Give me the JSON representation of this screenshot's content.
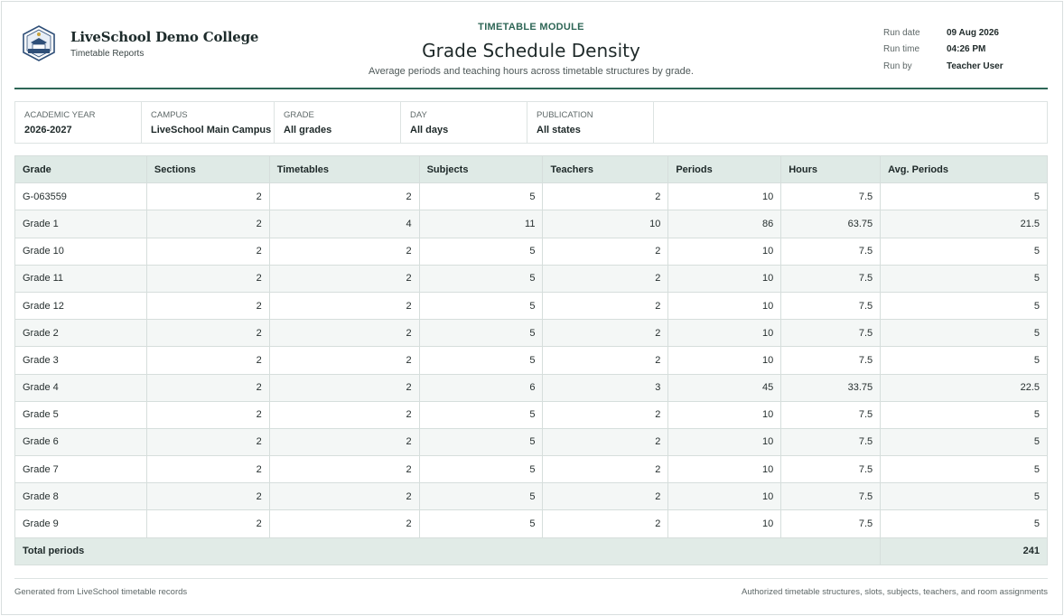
{
  "brand": {
    "name": "LiveSchool Demo College",
    "subtitle": "Timetable Reports",
    "logo_icon": "school-crest-icon"
  },
  "header": {
    "module": "TIMETABLE MODULE",
    "title": "Grade Schedule Density",
    "description": "Average periods and teaching hours across timetable structures by grade."
  },
  "meta": [
    {
      "label": "Run date",
      "value": "09 Aug 2026"
    },
    {
      "label": "Run time",
      "value": "04:26 PM"
    },
    {
      "label": "Run by",
      "value": "Teacher User"
    }
  ],
  "filters": [
    {
      "label": "ACADEMIC YEAR",
      "value": "2026-2027"
    },
    {
      "label": "CAMPUS",
      "value": "LiveSchool Main Campus"
    },
    {
      "label": "GRADE",
      "value": "All grades"
    },
    {
      "label": "DAY",
      "value": "All days"
    },
    {
      "label": "PUBLICATION",
      "value": "All states"
    }
  ],
  "table": {
    "columns": [
      "Grade",
      "Sections",
      "Timetables",
      "Subjects",
      "Teachers",
      "Periods",
      "Hours",
      "Avg. Periods"
    ],
    "rows": [
      [
        "G-063559",
        "2",
        "2",
        "5",
        "2",
        "10",
        "7.5",
        "5"
      ],
      [
        "Grade 1",
        "2",
        "4",
        "11",
        "10",
        "86",
        "63.75",
        "21.5"
      ],
      [
        "Grade 10",
        "2",
        "2",
        "5",
        "2",
        "10",
        "7.5",
        "5"
      ],
      [
        "Grade 11",
        "2",
        "2",
        "5",
        "2",
        "10",
        "7.5",
        "5"
      ],
      [
        "Grade 12",
        "2",
        "2",
        "5",
        "2",
        "10",
        "7.5",
        "5"
      ],
      [
        "Grade 2",
        "2",
        "2",
        "5",
        "2",
        "10",
        "7.5",
        "5"
      ],
      [
        "Grade 3",
        "2",
        "2",
        "5",
        "2",
        "10",
        "7.5",
        "5"
      ],
      [
        "Grade 4",
        "2",
        "2",
        "6",
        "3",
        "45",
        "33.75",
        "22.5"
      ],
      [
        "Grade 5",
        "2",
        "2",
        "5",
        "2",
        "10",
        "7.5",
        "5"
      ],
      [
        "Grade 6",
        "2",
        "2",
        "5",
        "2",
        "10",
        "7.5",
        "5"
      ],
      [
        "Grade 7",
        "2",
        "2",
        "5",
        "2",
        "10",
        "7.5",
        "5"
      ],
      [
        "Grade 8",
        "2",
        "2",
        "5",
        "2",
        "10",
        "7.5",
        "5"
      ],
      [
        "Grade 9",
        "2",
        "2",
        "5",
        "2",
        "10",
        "7.5",
        "5"
      ]
    ],
    "total": {
      "label": "Total periods",
      "value": "241"
    }
  },
  "footer": {
    "left": "Generated from LiveSchool timetable records",
    "right": "Authorized timetable structures, slots, subjects, teachers, and room assignments"
  },
  "colors": {
    "accent": "#2e6656",
    "header_bg": "#dfeae6",
    "row_alt": "#f4f7f6"
  }
}
